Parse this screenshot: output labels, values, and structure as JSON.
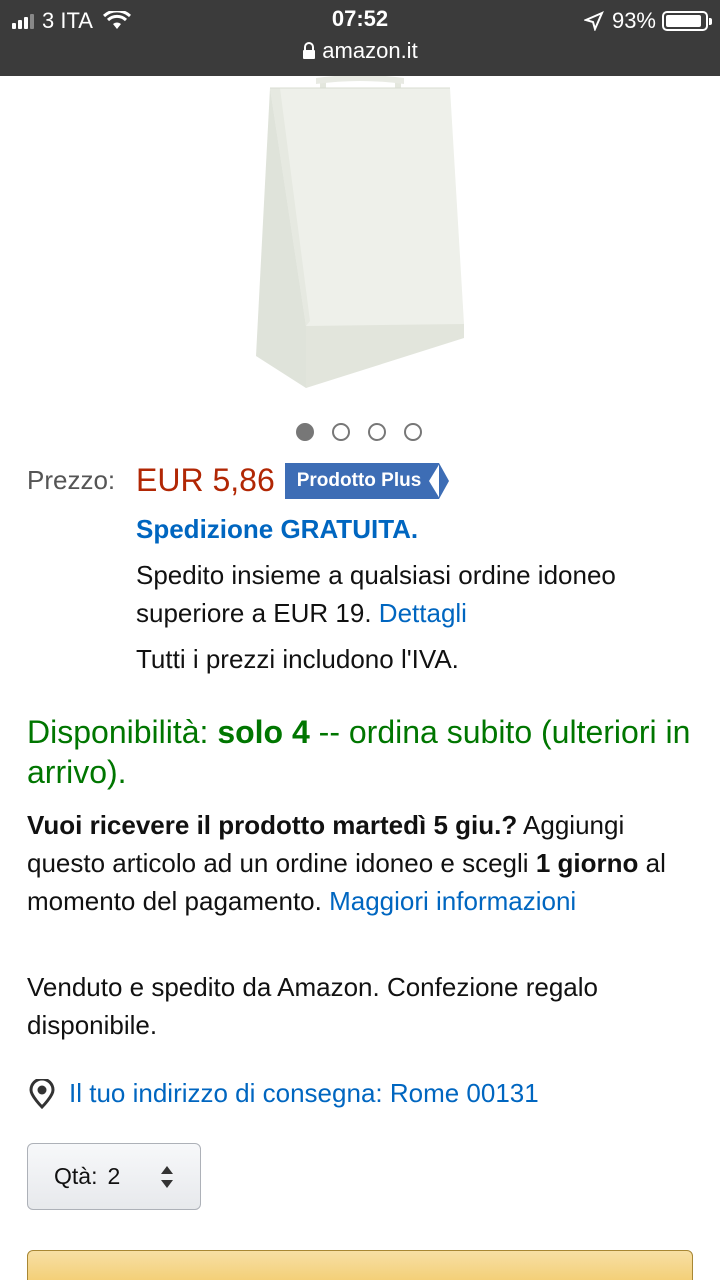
{
  "status_bar": {
    "carrier": "3 ITA",
    "time": "07:52",
    "battery": "93%",
    "battery_level": 0.93,
    "url": "amazon.it"
  },
  "carousel": {
    "count": 4,
    "active": 0
  },
  "price": {
    "label": "Prezzo:",
    "value": "EUR 5,86",
    "badge": "Prodotto Plus"
  },
  "shipping": {
    "free": "Spedizione GRATUITA.",
    "note": "Spedito insieme a qualsiasi ordine idoneo superiore a EUR 19.",
    "details_link": "Dettagli",
    "vat": "Tutti i prezzi includono l'IVA."
  },
  "availability": {
    "prefix": "Disponibilità:",
    "qty": "solo 4",
    "suffix": "-- ordina subito (ulteriori in arrivo)."
  },
  "delivery": {
    "question": "Vuoi ricevere il prodotto martedì 5 giu.?",
    "text1": "Aggiungi questo articolo ad un ordine idoneo e scegli",
    "option": "1 giorno",
    "text2": "al momento del pagamento.",
    "more_link": "Maggiori informazioni"
  },
  "seller": "Venduto e spedito da Amazon. Confezione regalo disponibile.",
  "address": "Il tuo indirizzo di consegna: Rome 00131",
  "quantity": {
    "label": "Qtà:",
    "value": "2"
  },
  "colors": {
    "price": "#b12704",
    "link": "#0066c0",
    "stock": "#007600",
    "badge": "#3d6db5"
  },
  "icons": [
    "signal-icon",
    "wifi-icon",
    "lock-icon",
    "location-arrow-icon",
    "battery-icon",
    "location-pin-icon",
    "select-arrows-icon"
  ]
}
